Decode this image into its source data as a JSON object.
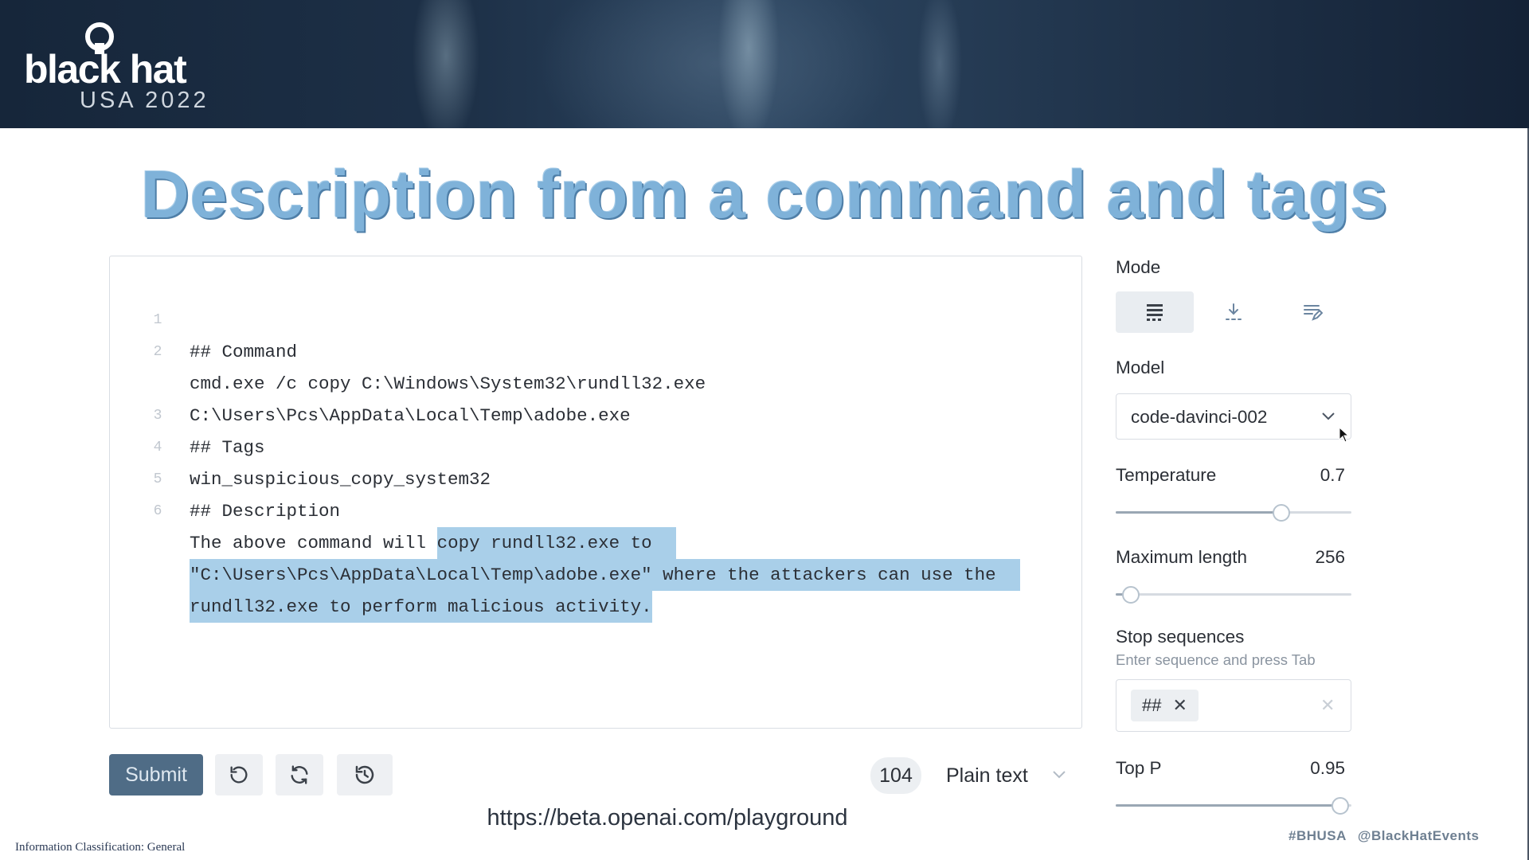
{
  "banner": {
    "logo_line1": "black hat",
    "logo_line2": "USA 2022"
  },
  "slide": {
    "title": "Description from a command and tags",
    "url": "https://beta.openai.com/playground",
    "footer_classification": "Information Classification: General",
    "footer_hashtag": "#BHUSA",
    "footer_handle": "@BlackHatEvents"
  },
  "editor": {
    "lines": [
      {
        "num": "1",
        "text": "## Command"
      },
      {
        "num": "2",
        "text": "cmd.exe /c copy C:\\Windows\\System32\\rundll32.exe"
      },
      {
        "num": "",
        "text": "C:\\Users\\Pcs\\AppData\\Local\\Temp\\adobe.exe"
      },
      {
        "num": "3",
        "text": "## Tags"
      },
      {
        "num": "4",
        "text": "win_suspicious_copy_system32"
      },
      {
        "num": "5",
        "text": "## Description"
      },
      {
        "num": "6",
        "text_plain": "The above command will ",
        "text_completion": "copy rundll32.exe to"
      },
      {
        "num": "",
        "text_completion": "\"C:\\Users\\Pcs\\AppData\\Local\\Temp\\adobe.exe\" where the attackers can use the"
      },
      {
        "num": "",
        "text_completion": "rundll32.exe to perform malicious activity."
      }
    ]
  },
  "toolbar": {
    "submit_label": "Submit",
    "undo_icon": "undo-icon",
    "regenerate_icon": "regenerate-icon",
    "history_icon": "history-icon",
    "token_count": "104",
    "format_value": "Plain text"
  },
  "settings": {
    "mode_label": "Mode",
    "mode_tabs": [
      "complete-icon",
      "insert-icon",
      "edit-icon"
    ],
    "mode_active": 0,
    "model_label": "Model",
    "model_value": "code-davinci-002",
    "temperature": {
      "label": "Temperature",
      "value": "0.7",
      "fraction": 0.7
    },
    "max_length": {
      "label": "Maximum length",
      "value": "256",
      "fraction": 0.06
    },
    "stop_sequences": {
      "label": "Stop sequences",
      "hint": "Enter sequence and press Tab",
      "chips": [
        "##"
      ]
    },
    "top_p": {
      "label": "Top P",
      "value": "0.95",
      "fraction": 0.95
    }
  },
  "colors": {
    "title": "#7fb2d9",
    "highlight": "#a9cfe9",
    "submit_bg": "#4f6c86",
    "banner": "#1d3047"
  }
}
